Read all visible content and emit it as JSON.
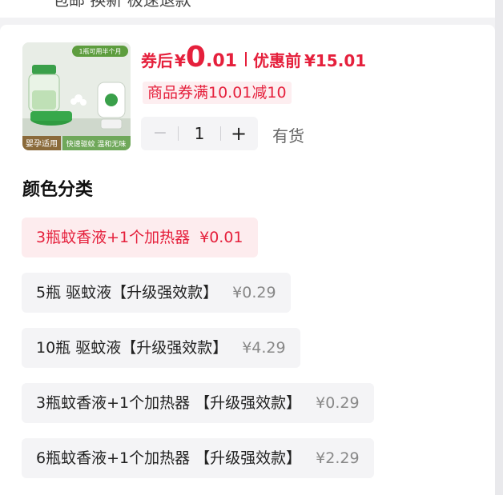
{
  "header": {
    "truncated_text": "包邮 换新 极速退款"
  },
  "product": {
    "image_alt": "蚊香液产品图",
    "image_badge": "1瓶可用半个月",
    "image_tag1": "婴孕适用",
    "image_tag2": "快速驱蚊 温和无味",
    "price": {
      "label": "券后",
      "symbol": "¥",
      "int": "0",
      "dec": ".01",
      "orig_label": "优惠前",
      "orig": "¥15.01"
    },
    "coupon": "商品券满10.01减10",
    "quantity": {
      "minus": "−",
      "value": "1",
      "plus": "+"
    },
    "stock": "有货"
  },
  "variants": {
    "title": "颜色分类",
    "items": [
      {
        "label": "3瓶蚊香液+1个加热器",
        "price": "¥0.01",
        "selected": true
      },
      {
        "label": "5瓶 驱蚊液【升级强效款】",
        "price": "¥0.29",
        "selected": false
      },
      {
        "label": "10瓶 驱蚊液【升级强效款】",
        "price": "¥4.29",
        "selected": false
      },
      {
        "label": "3瓶蚊香液+1个加热器 【升级强效款】",
        "price": "¥0.29",
        "selected": false
      },
      {
        "label": "6瓶蚊香液+1个加热器 【升级强效款】",
        "price": "¥2.29",
        "selected": false
      }
    ]
  },
  "colors": {
    "accent": "#e5203c",
    "coupon_bg": "#fdeef0",
    "chip_bg": "#f4f4f6",
    "selected_bg": "#fdecee"
  }
}
